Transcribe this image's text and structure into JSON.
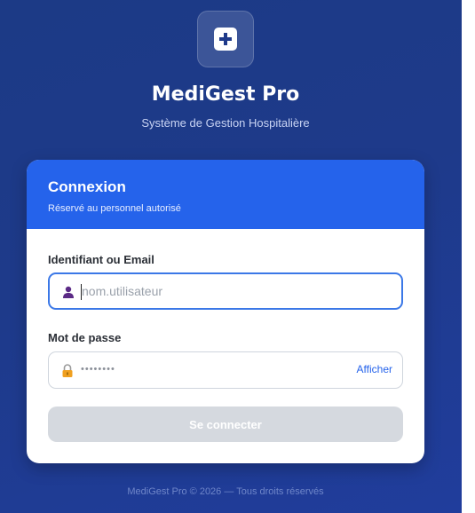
{
  "app": {
    "name": "MediGest Pro",
    "subtitle": "Système de Gestion Hospitalière",
    "logo_icon": "medical-plus-icon"
  },
  "login_card": {
    "title": "Connexion",
    "subtitle": "Réservé au personnel autorisé",
    "username": {
      "label": "Identifiant ou Email",
      "placeholder": "nom.utilisateur",
      "value": "",
      "icon": "user-icon",
      "focused": true
    },
    "password": {
      "label": "Mot de passe",
      "masked_value": "••••••••",
      "icon": "lock-icon",
      "toggle_label": "Afficher"
    },
    "submit_label": "Se connecter",
    "submit_enabled": false
  },
  "footer": {
    "text": "MediGest Pro © 2026 — Tous droits réservés"
  },
  "colors": {
    "background": "#1e3a8a",
    "accent": "#2563eb",
    "disabled_button": "#d5d9df"
  }
}
